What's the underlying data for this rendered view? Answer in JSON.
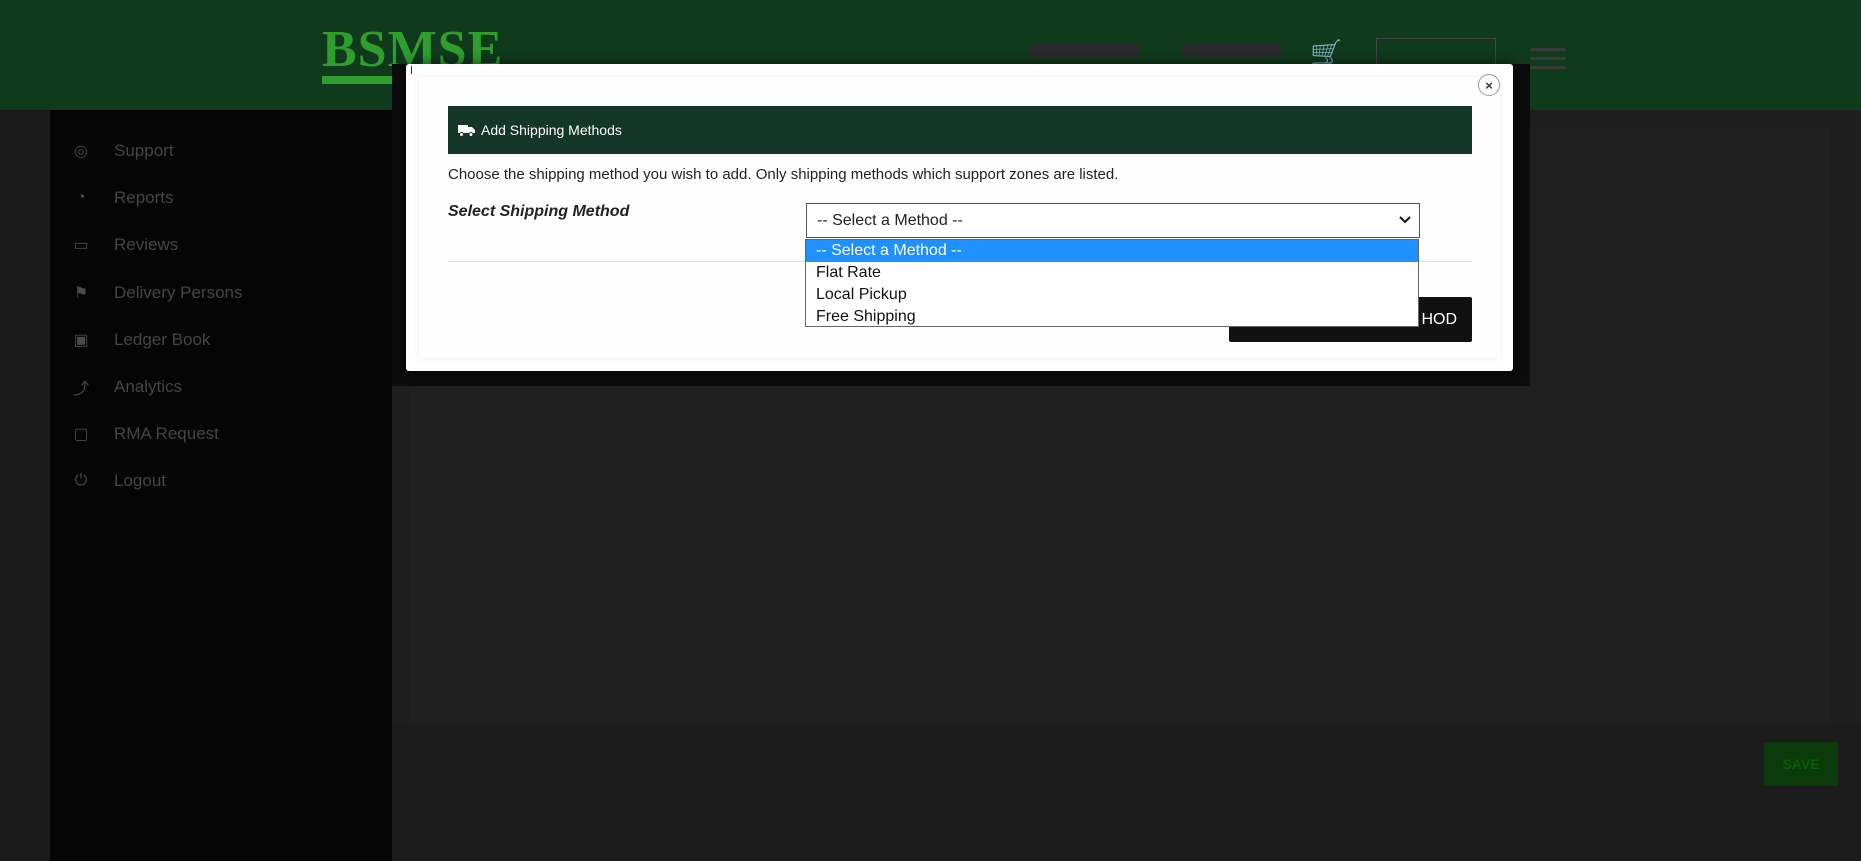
{
  "modal": {
    "title": "Add Shipping Methods",
    "description": "Choose the shipping method you wish to add. Only shipping methods which support zones are listed.",
    "field_label": "Select Shipping Method",
    "select_value": "-- Select a Method --",
    "add_button_partial": "HOD",
    "close_icon": "×",
    "options": [
      {
        "label": "-- Select a Method --",
        "selected": true
      },
      {
        "label": "Flat Rate",
        "selected": false
      },
      {
        "label": "Local Pickup",
        "selected": false
      },
      {
        "label": "Free Shipping",
        "selected": false
      }
    ]
  },
  "sidebar": {
    "items": [
      {
        "label": "Support",
        "icon": "support-icon"
      },
      {
        "label": "Reports",
        "icon": "reports-icon"
      },
      {
        "label": "Reviews",
        "icon": "reviews-icon"
      },
      {
        "label": "Delivery Persons",
        "icon": "delivery-icon"
      },
      {
        "label": "Ledger Book",
        "icon": "ledger-icon"
      },
      {
        "label": "Analytics",
        "icon": "analytics-icon"
      },
      {
        "label": "RMA Request",
        "icon": "rma-icon"
      },
      {
        "label": "Logout",
        "icon": "logout-icon"
      }
    ]
  },
  "content": {
    "save_label": "SAVE"
  },
  "colors": {
    "modal_header": "#15372a",
    "selected_option": "#1e90ff",
    "site_header": "#0f3a1c",
    "accent_green": "#2f9e2f"
  }
}
